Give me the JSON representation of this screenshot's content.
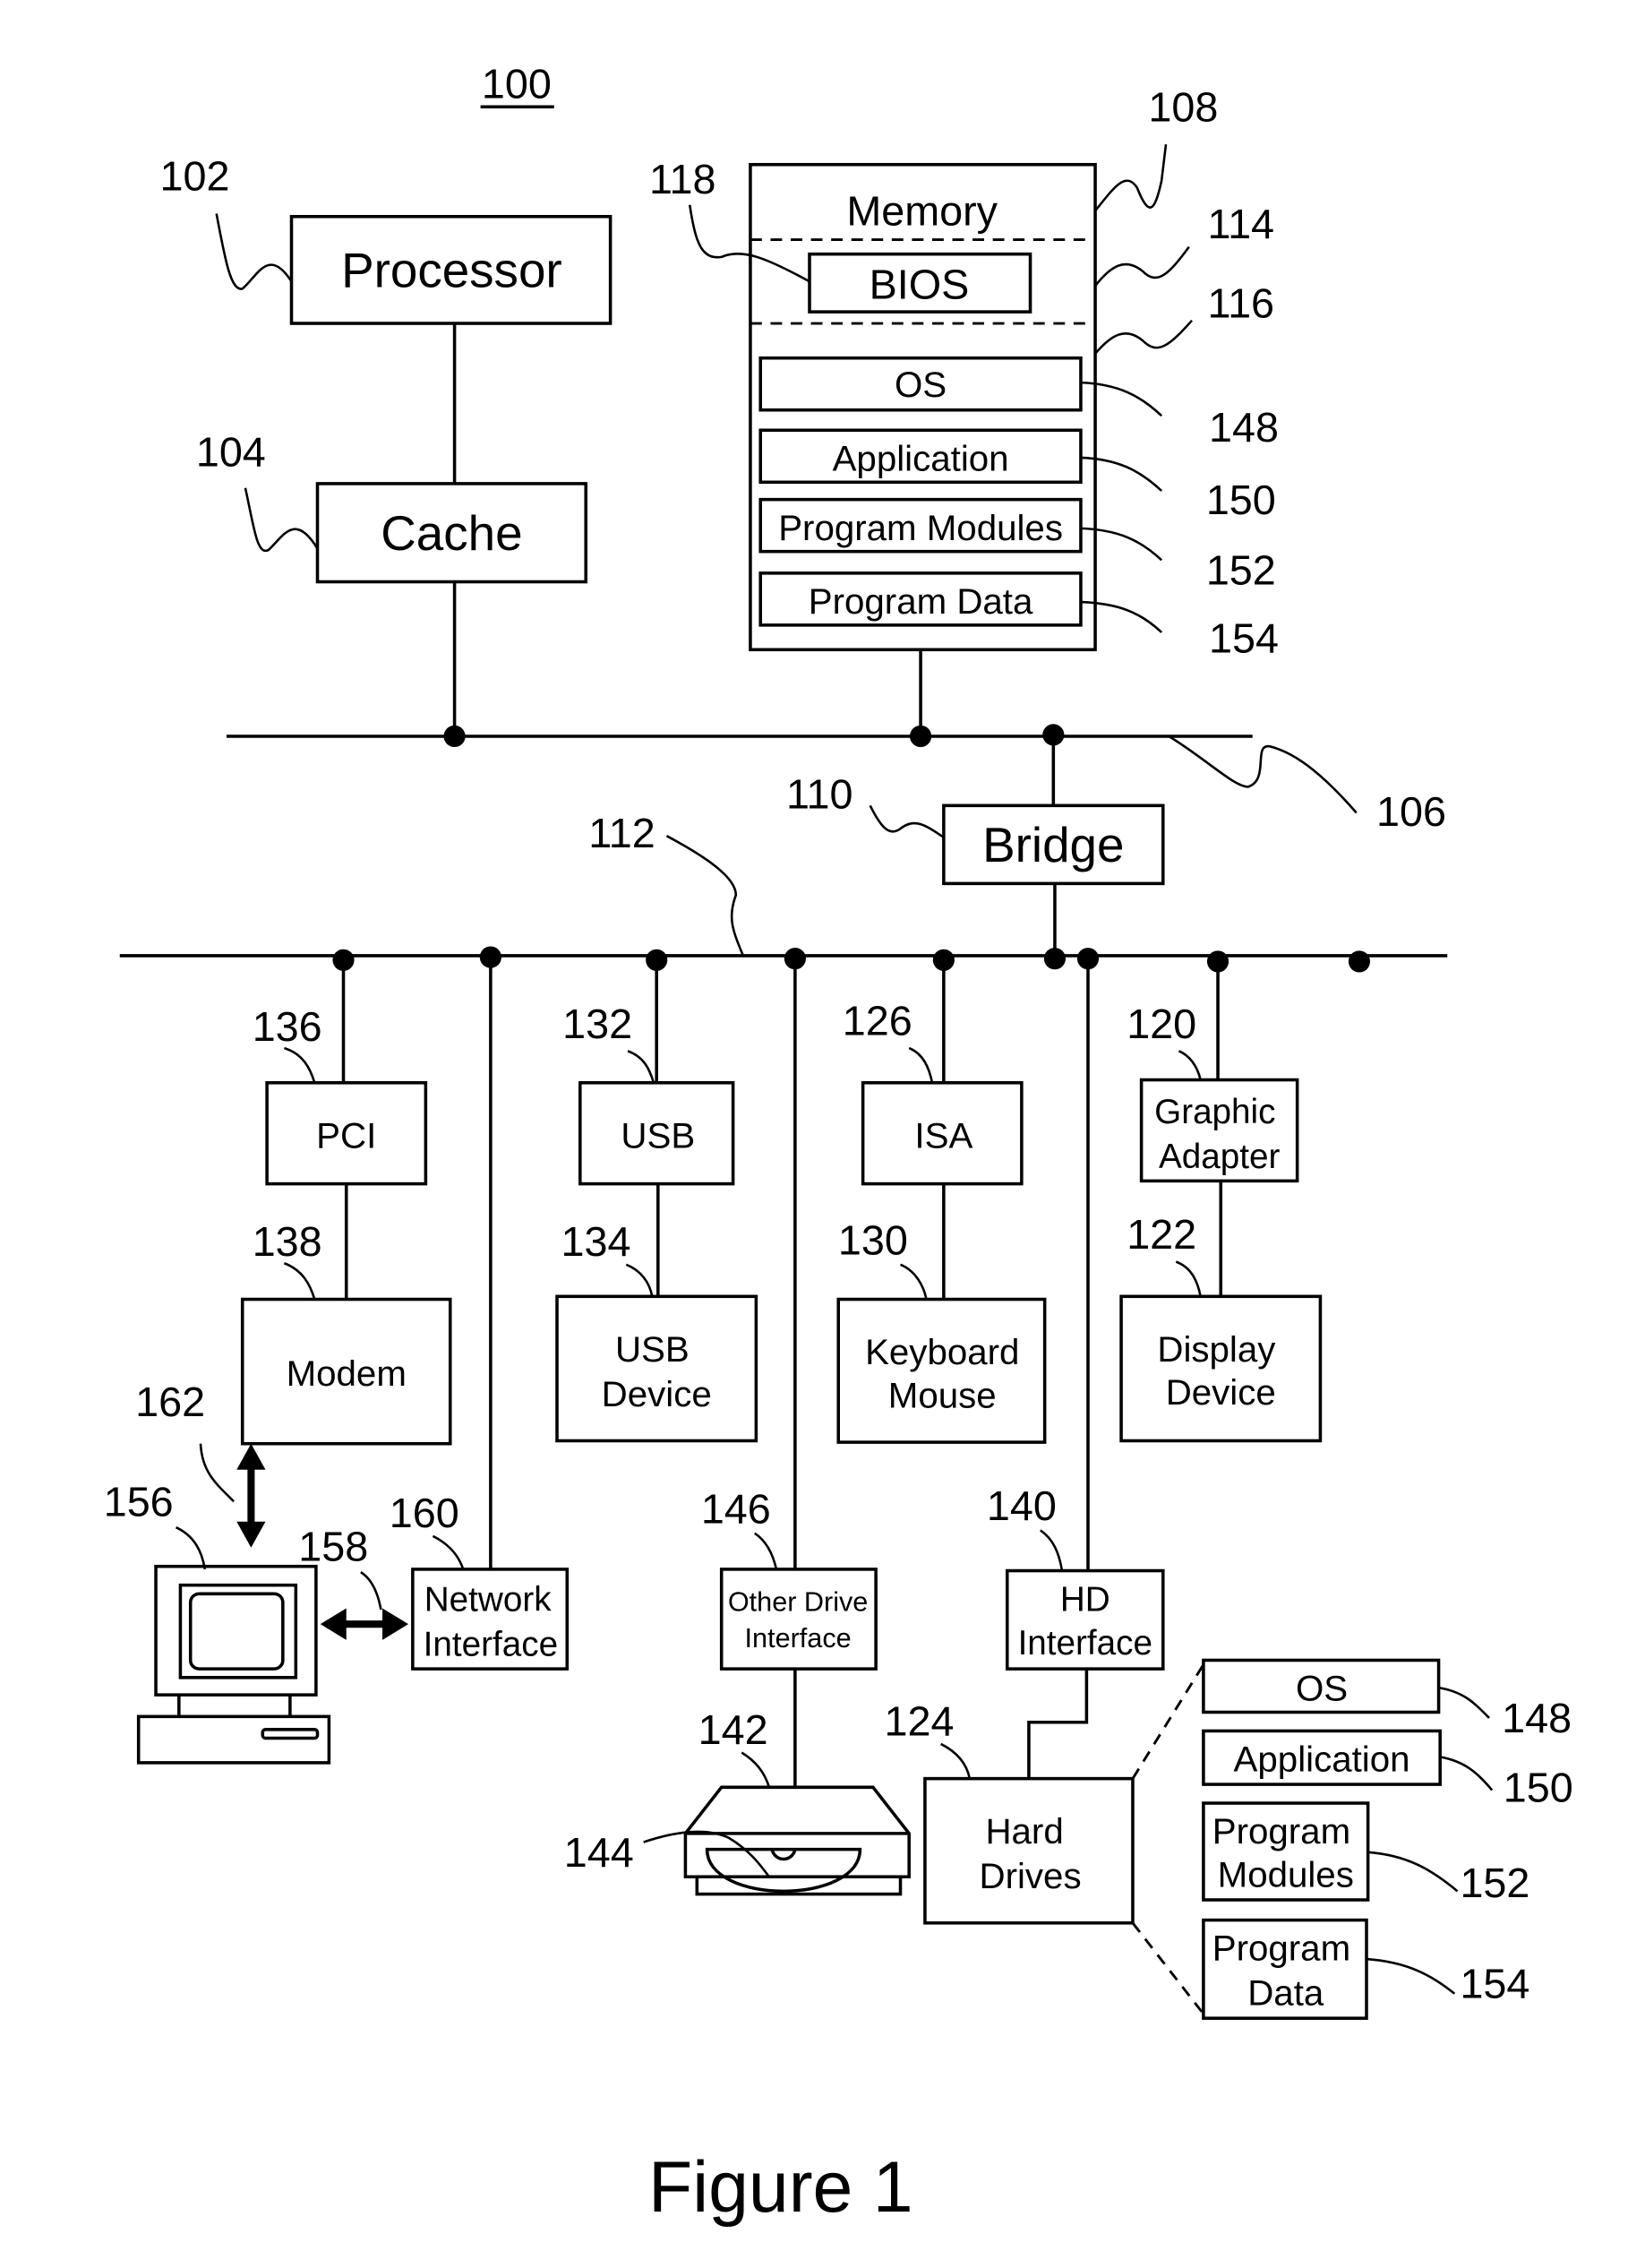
{
  "figure": {
    "number_label": "100",
    "caption": "Figure 1"
  },
  "components": {
    "processor": {
      "ref": "102",
      "label": "Processor"
    },
    "cache": {
      "ref": "104",
      "label": "Cache"
    },
    "system_bus": {
      "ref": "106"
    },
    "memory": {
      "ref": "108",
      "label": "Memory",
      "rom_ref": "114",
      "ram_ref": "116",
      "bios": {
        "ref": "118",
        "label": "BIOS"
      },
      "items": [
        {
          "ref": "148",
          "label": "OS"
        },
        {
          "ref": "150",
          "label": "Application"
        },
        {
          "ref": "152",
          "label": "Program Modules"
        },
        {
          "ref": "154",
          "label": "Program Data"
        }
      ]
    },
    "bridge": {
      "ref": "110",
      "label": "Bridge"
    },
    "io_bus": {
      "ref": "112"
    },
    "pci": {
      "ref": "136",
      "label": "PCI"
    },
    "modem": {
      "ref": "138",
      "label": "Modem"
    },
    "usb": {
      "ref": "132",
      "label": "USB"
    },
    "usb_device": {
      "ref": "134",
      "label_line1": "USB",
      "label_line2": "Device"
    },
    "isa": {
      "ref": "126",
      "label": "ISA"
    },
    "keyboard_mouse": {
      "ref": "130",
      "label_line1": "Keyboard",
      "label_line2": "Mouse"
    },
    "graphic_adapter": {
      "ref": "120",
      "label_line1": "Graphic",
      "label_line2": "Adapter"
    },
    "display_device": {
      "ref": "122",
      "label_line1": "Display",
      "label_line2": "Device"
    },
    "remote_computer": {
      "ref": "156"
    },
    "network_link": {
      "ref": "158"
    },
    "modem_link": {
      "ref": "162"
    },
    "network_interface": {
      "ref": "160",
      "label_line1": "Network",
      "label_line2": "Interface"
    },
    "other_drive_interface": {
      "ref": "146",
      "label_line1": "Other Drive",
      "label_line2": "Interface"
    },
    "drive": {
      "ref": "142"
    },
    "disc": {
      "ref": "144"
    },
    "hd_interface": {
      "ref": "140",
      "label_line1": "HD",
      "label_line2": "Interface"
    },
    "hard_drives": {
      "ref": "124",
      "label_line1": "Hard",
      "label_line2": "Drives",
      "items": [
        {
          "ref": "148",
          "label_line1": "OS",
          "label_line2": ""
        },
        {
          "ref": "150",
          "label_line1": "Application",
          "label_line2": ""
        },
        {
          "ref": "152",
          "label_line1": "Program",
          "label_line2": "Modules"
        },
        {
          "ref": "154",
          "label_line1": "Program",
          "label_line2": "Data"
        }
      ]
    }
  }
}
